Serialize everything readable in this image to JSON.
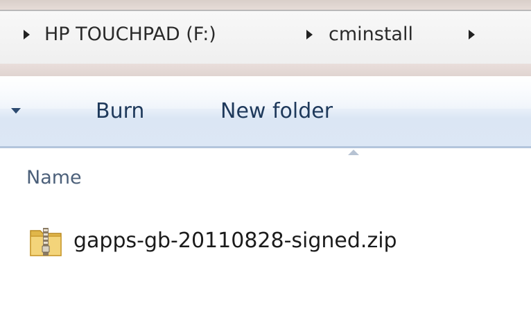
{
  "breadcrumb": {
    "items": [
      "HP TOUCHPAD (F:)",
      "cminstall"
    ]
  },
  "toolbar": {
    "burn_label": "Burn",
    "new_folder_label": "New folder"
  },
  "file_list": {
    "columns": [
      "Name"
    ],
    "files": [
      {
        "name": "gapps-gb-20110828-signed.zip",
        "icon": "zip-folder-icon"
      }
    ]
  },
  "colors": {
    "toolbar_text": "#1e395b",
    "header_text": "#4c607a",
    "toolbar_bg": "#dce7f5"
  }
}
